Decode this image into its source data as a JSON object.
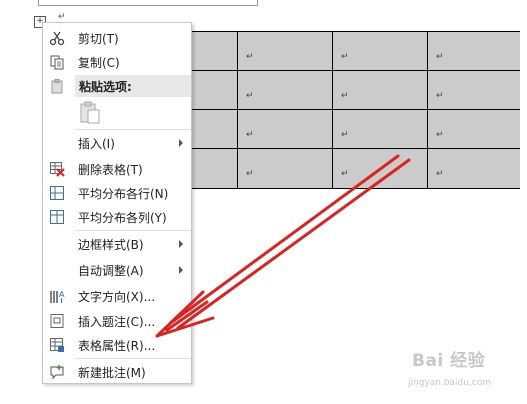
{
  "document": {
    "paragraph_mark": "↵",
    "move_handle_glyph": "+",
    "table": {
      "rows": 4,
      "columns": 4,
      "cell_mark": "↵",
      "background_color": "#cbcbcb"
    }
  },
  "context_menu": {
    "items": [
      {
        "label": "剪切(T)",
        "icon": "scissors-icon"
      },
      {
        "label": "复制(C)",
        "icon": "copy-icon"
      },
      {
        "label": "粘贴选项:",
        "icon": "paste-icon"
      },
      {
        "label": "插入(I)",
        "icon": "",
        "submenu": true
      },
      {
        "label": "删除表格(T)",
        "icon": "delete-table-icon"
      },
      {
        "label": "平均分布各行(N)",
        "icon": "distribute-rows-icon"
      },
      {
        "label": "平均分布各列(Y)",
        "icon": "distribute-columns-icon"
      },
      {
        "label": "边框样式(B)",
        "icon": "",
        "submenu": true
      },
      {
        "label": "自动调整(A)",
        "icon": "",
        "submenu": true
      },
      {
        "label": "文字方向(X)...",
        "icon": "text-direction-icon"
      },
      {
        "label": "插入题注(C)...",
        "icon": "insert-caption-icon"
      },
      {
        "label": "表格属性(R)...",
        "icon": "table-properties-icon"
      },
      {
        "label": "新建批注(M)",
        "icon": "new-comment-icon"
      }
    ]
  },
  "annotation": {
    "color": "#e02020"
  },
  "watermark": {
    "text": "Bai 经验",
    "url": "jingyan.baidu.com"
  }
}
